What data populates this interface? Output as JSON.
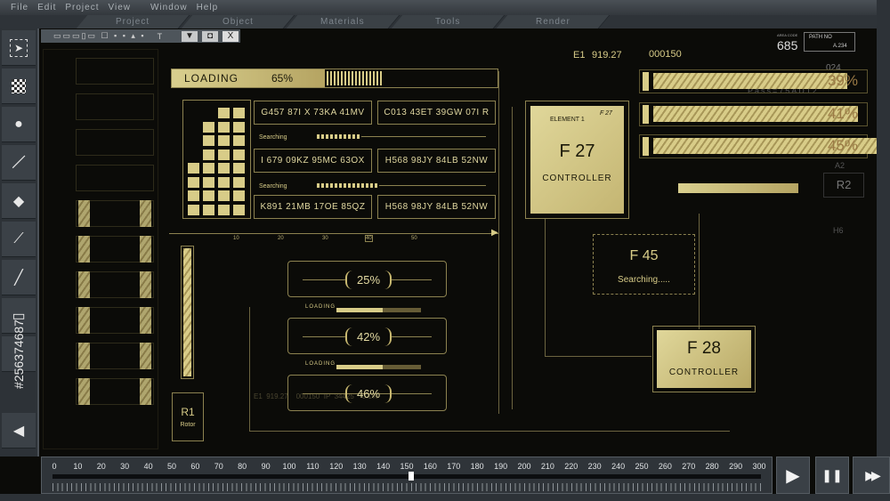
{
  "menu": [
    "File",
    "Edit",
    "Project",
    "View",
    "Window",
    "Help"
  ],
  "tabs": [
    "Project",
    "Object",
    "Materials",
    "Tools",
    "Render"
  ],
  "tools": [
    "select-tool",
    "checker-tool",
    "point-tool",
    "line-tool",
    "fill-tool",
    "node-tool",
    "curve-tool",
    "slot-tool",
    "text-tool",
    "move-tool"
  ],
  "panel": {
    "text_tool": "T",
    "down": "▼",
    "restore": "◘",
    "close": "X"
  },
  "loading": {
    "label": "LOADING",
    "value": "65%",
    "progress": 0.65
  },
  "codes": [
    [
      "G457  87I X  73KA  41MV",
      "C013  43ET  39GW  07I R"
    ],
    [
      "I 679  09KZ  95MC  63OX",
      "H568  98JY  84LB  52NW"
    ],
    [
      "K891  21MB  17OE  85QZ",
      "H568  98JY  84LB  52NW"
    ]
  ],
  "searching": [
    "Searching",
    "Searching"
  ],
  "ruler": [
    "10",
    "20",
    "30",
    "40",
    "50"
  ],
  "element": {
    "label": "ELEMENT 1",
    "tag": "F 27",
    "title": "F 27",
    "sub": "CONTROLLER"
  },
  "f45": {
    "title": "F 45",
    "sub": "Searching....."
  },
  "f28": {
    "title": "F 28",
    "sub": "CONTROLLER"
  },
  "readout": {
    "e1": "E1",
    "e1_value": "919.27",
    "counter": "000150",
    "area_label": "AREA CODE",
    "area_code": "685",
    "path_label": "PATH NO",
    "path_value": "A.234",
    "top_num": "024",
    "pass": "Pass=75AD12",
    "a2": "A2",
    "h6": "H6"
  },
  "right_bars": [
    {
      "value": "39%",
      "progress": 0.39
    },
    {
      "value": "41%",
      "progress": 0.41
    },
    {
      "value": "45%",
      "progress": 0.45
    }
  ],
  "r2": "R2",
  "r1": {
    "title": "R1",
    "sub": "Rotor"
  },
  "gauges": [
    {
      "value": "25%"
    },
    {
      "value": "42%",
      "loading": "LOADING"
    },
    {
      "value": "46%",
      "loading": "LOADING"
    }
  ],
  "faint_readout": "E1  919.27    000150  IP  34425    0.1%",
  "timeline": {
    "ticks": [
      "0",
      "10",
      "20",
      "30",
      "40",
      "50",
      "60",
      "70",
      "80",
      "90",
      "100",
      "110",
      "120",
      "130",
      "140",
      "150",
      "160",
      "170",
      "180",
      "190",
      "200",
      "210",
      "220",
      "230",
      "240",
      "250",
      "260",
      "270",
      "280",
      "290",
      "300"
    ],
    "position": 152
  },
  "controls": {
    "play": "▶",
    "pause": "❚❚",
    "forward": "▶▶"
  },
  "watermark": "#256374687",
  "colors": {
    "gold": "#d8cc88",
    "line": "#8c8250",
    "bg": "#0b0b08",
    "chrome": "#3b4147"
  }
}
